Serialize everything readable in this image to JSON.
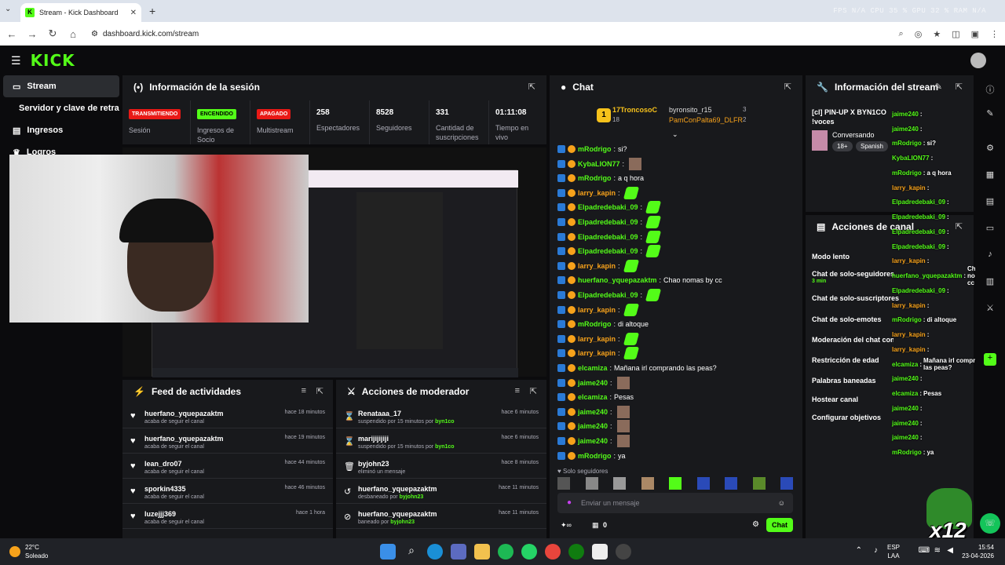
{
  "browser": {
    "tab_title": "Stream - Kick Dashboard",
    "url": "dashboard.kick.com/stream",
    "perf": "FPS N/A   CPU 35 %   GPU 32 %   RAM N/A"
  },
  "sidebar": {
    "items": [
      {
        "label": "Stream"
      },
      {
        "label": "Servidor y clave de retransmisión"
      },
      {
        "label": "Ingresos"
      },
      {
        "label": "Logros"
      }
    ]
  },
  "session": {
    "title": "Información de la sesión",
    "badges": [
      {
        "text": "TRANSMITIENDO",
        "label": "Sesión",
        "color": "#e91916"
      },
      {
        "text": "ENCENDIDO",
        "label": "Ingresos de Socio",
        "color": "#53fc18"
      },
      {
        "text": "APAGADO",
        "label": "Multistream",
        "color": "#e91916"
      }
    ],
    "stats": [
      {
        "value": "258",
        "label": "Espectadores"
      },
      {
        "value": "8528",
        "label": "Seguidores"
      },
      {
        "value": "331",
        "label": "Cantidad de suscripciones"
      },
      {
        "value": "01:11:08",
        "label": "Tiempo en vivo"
      }
    ]
  },
  "feed": {
    "title": "Feed de actividades",
    "rows": [
      {
        "name": "huerfano_yquepazaktm",
        "sub": "acaba de seguir el canal",
        "time": "hace 18 minutos"
      },
      {
        "name": "huerfano_yquepazaktm",
        "sub": "acaba de seguir el canal",
        "time": "hace 19 minutos"
      },
      {
        "name": "lean_dro07",
        "sub": "acaba de seguir el canal",
        "time": "hace 44 minutos"
      },
      {
        "name": "sporkin4335",
        "sub": "acaba de seguir el canal",
        "time": "hace 46 minutos"
      },
      {
        "name": "luzejjj369",
        "sub": "acaba de seguir el canal",
        "time": "hace 1 hora"
      }
    ]
  },
  "mod": {
    "title": "Acciones de moderador",
    "rows": [
      {
        "name": "Renataaa_17",
        "sub": "suspendido por 15 minutos por",
        "by": "byn1co",
        "time": "hace 6 minutos"
      },
      {
        "name": "marijijijiji",
        "sub": "suspendido por 15 minutos por",
        "by": "byn1co",
        "time": "hace 6 minutos"
      },
      {
        "name": "byjohn23",
        "sub": "eliminó un mensaje",
        "by": "",
        "time": "hace 8 minutos"
      },
      {
        "name": "huerfano_yquepazaktm",
        "sub": "desbaneado por",
        "by": "byjohn23",
        "time": "hace 11 minutos"
      },
      {
        "name": "huerfano_yquepazaktm",
        "sub": "baneado por",
        "by": "byjohn23",
        "time": "hace 11 minutos"
      }
    ]
  },
  "chat": {
    "title": "Chat",
    "leaderboard": [
      {
        "name": "17TroncosoC",
        "score": "18"
      },
      {
        "name": "byronsito_r15",
        "score": "3"
      },
      {
        "name": "PamConPalta69_DLFR",
        "score": "2"
      }
    ],
    "messages": [
      {
        "user": "mRodrigo",
        "text": "si?",
        "color": "#53fc18"
      },
      {
        "user": "KybaLION77",
        "text": "",
        "color": "#53fc18"
      },
      {
        "user": "mRodrigo",
        "text": "a q hora",
        "color": "#53fc18"
      },
      {
        "user": "larry_kapin",
        "text": "",
        "color": "#f7a21b"
      },
      {
        "user": "Elpadredebaki_09",
        "text": "",
        "color": "#53fc18"
      },
      {
        "user": "Elpadredebaki_09",
        "text": "",
        "color": "#53fc18"
      },
      {
        "user": "Elpadredebaki_09",
        "text": "",
        "color": "#53fc18"
      },
      {
        "user": "Elpadredebaki_09",
        "text": "",
        "color": "#53fc18"
      },
      {
        "user": "larry_kapin",
        "text": "",
        "color": "#f7a21b"
      },
      {
        "user": "huerfano_yquepazaktm",
        "text": "Chao nomas by cc",
        "color": "#53fc18"
      },
      {
        "user": "Elpadredebaki_09",
        "text": "",
        "color": "#53fc18"
      },
      {
        "user": "larry_kapin",
        "text": "",
        "color": "#f7a21b"
      },
      {
        "user": "mRodrigo",
        "text": "di altoque",
        "color": "#53fc18"
      },
      {
        "user": "larry_kapin",
        "text": "",
        "color": "#f7a21b"
      },
      {
        "user": "larry_kapin",
        "text": "",
        "color": "#f7a21b"
      },
      {
        "user": "elcamiza",
        "text": "Mañana irl comprando las peas?",
        "color": "#53fc18"
      },
      {
        "user": "jaime240",
        "text": "",
        "color": "#53fc18"
      },
      {
        "user": "elcamiza",
        "text": "Pesas",
        "color": "#53fc18"
      },
      {
        "user": "jaime240",
        "text": "",
        "color": "#53fc18"
      },
      {
        "user": "jaime240",
        "text": "",
        "color": "#53fc18"
      },
      {
        "user": "jaime240",
        "text": "",
        "color": "#53fc18"
      },
      {
        "user": "mRodrigo",
        "text": "ya",
        "color": "#53fc18"
      }
    ],
    "followers_only": "Solo seguidores",
    "placeholder": "Enviar un mensaje",
    "send": "Chat",
    "points": "0"
  },
  "stream_info": {
    "title": "Información del stream",
    "stream_title": "[cl] PIN-UP X BYN1CO",
    "stream_title2": "!voces",
    "category": "Conversando",
    "tags": [
      "18+",
      "Spanish"
    ]
  },
  "channel_actions": {
    "title": "Acciones de canal",
    "items": [
      "Modo lento",
      "Chat de solo-seguidores",
      "Chat de solo-suscriptores",
      "Chat de solo-emotes",
      "Moderación del chat con IA",
      "Restricción de edad",
      "Palabras baneadas",
      "Hostear canal",
      "Configurar objetivos"
    ],
    "followers_duration": "3 min"
  },
  "overlay": {
    "lines": [
      {
        "user": "jaime240",
        "text": ""
      },
      {
        "user": "jaime240",
        "text": ""
      },
      {
        "user": "mRodrigo",
        "text": "si?"
      },
      {
        "user": "KybaLION77",
        "text": ""
      },
      {
        "user": "mRodrigo",
        "text": "a q hora"
      },
      {
        "user": "larry_kapin",
        "text": ""
      },
      {
        "user": "Elpadredebaki_09",
        "text": ""
      },
      {
        "user": "Elpadredebaki_09",
        "text": ""
      },
      {
        "user": "Elpadredebaki_09",
        "text": ""
      },
      {
        "user": "Elpadredebaki_09",
        "text": ""
      },
      {
        "user": "larry_kapin",
        "text": ""
      },
      {
        "user": "huerfano_yquepazaktm",
        "text": "Chao nomas by cc"
      },
      {
        "user": "Elpadredebaki_09",
        "text": ""
      },
      {
        "user": "larry_kapin",
        "text": ""
      },
      {
        "user": "mRodrigo",
        "text": "di altoque"
      },
      {
        "user": "larry_kapin",
        "text": ""
      },
      {
        "user": "larry_kapin",
        "text": ""
      },
      {
        "user": "elcamiza",
        "text": "Mañana irl comprando las peas?"
      },
      {
        "user": "jaime240",
        "text": ""
      },
      {
        "user": "elcamiza",
        "text": "Pesas"
      },
      {
        "user": "jaime240",
        "text": ""
      },
      {
        "user": "jaime240",
        "text": ""
      },
      {
        "user": "jaime240",
        "text": ""
      },
      {
        "user": "mRodrigo",
        "text": "ya"
      }
    ],
    "badge": "x12"
  },
  "taskbar": {
    "temp": "22°C",
    "weather": "Soleado",
    "lang1": "ESP",
    "lang2": "LAA",
    "time": "15:54",
    "date": "23-04-2026"
  }
}
